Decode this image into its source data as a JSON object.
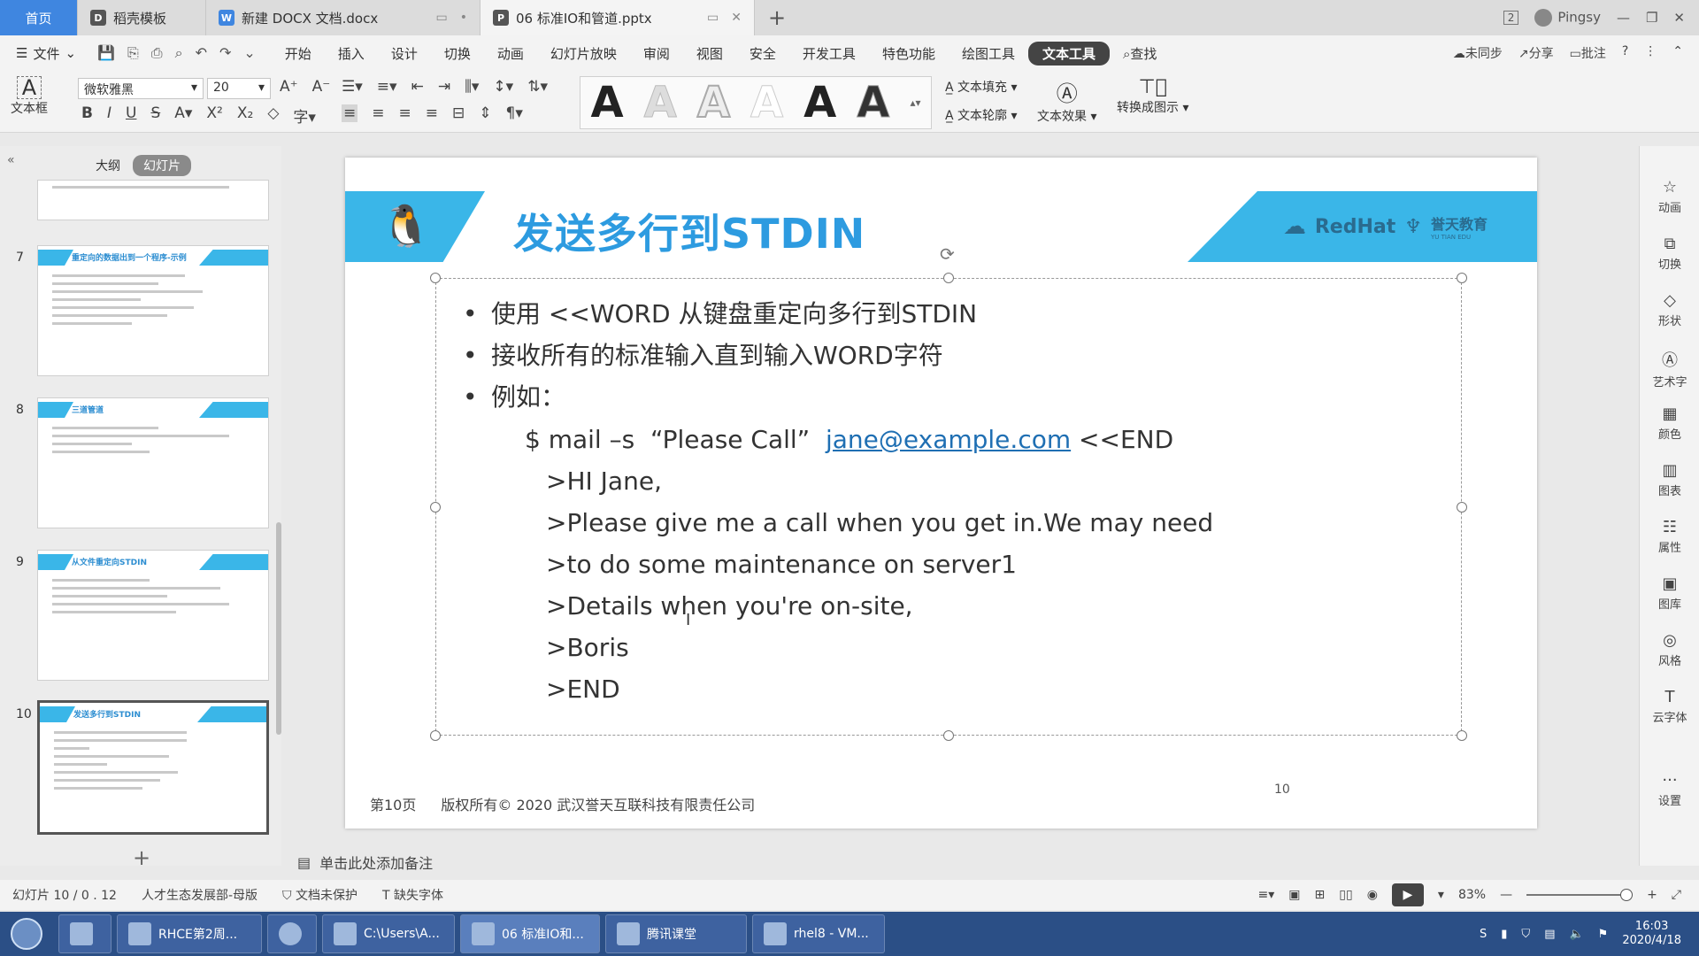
{
  "tabs": [
    {
      "label": "首页"
    },
    {
      "label": "稻壳模板"
    },
    {
      "label": "新建 DOCX 文档.docx"
    },
    {
      "label": "06 标准IO和管道.pptx"
    }
  ],
  "tabbar": {
    "window_count": "2",
    "user": "Pingsy"
  },
  "menu": {
    "file": "文件",
    "items": [
      "开始",
      "插入",
      "设计",
      "切换",
      "动画",
      "幻灯片放映",
      "审阅",
      "视图",
      "安全",
      "开发工具",
      "特色功能",
      "绘图工具"
    ],
    "active": "文本工具",
    "search": "查找",
    "sync": "未同步",
    "share": "分享",
    "comment": "批注"
  },
  "ribbon": {
    "textbox_label": "文本框",
    "font_name": "微软雅黑",
    "font_size": "20",
    "text_fill": "文本填充",
    "text_outline": "文本轮廓",
    "text_effect": "文本效果",
    "convert": "转换成图示",
    "style_glyph": "A"
  },
  "left_panel": {
    "tab_outline": "大纲",
    "tab_slides": "幻灯片",
    "thumbs": [
      {
        "num": "7",
        "title": "重定向的数据出到一个程序-示例"
      },
      {
        "num": "8",
        "title": "三道管道"
      },
      {
        "num": "9",
        "title": "从文件重定向STDIN"
      },
      {
        "num": "10",
        "title": "发送多行到STDIN"
      }
    ],
    "add": "+"
  },
  "slide": {
    "title": "发送多行到STDIN",
    "brand_redhat": "RedHat",
    "brand_yutian": "誉天教育",
    "brand_yutian_sub": "YU TIAN EDU",
    "bullets": [
      "使用 <<WORD 从键盘重定向多行到STDIN",
      "接收所有的标准输入直到输入WORD字符",
      "例如："
    ],
    "command_prefix": "$ mail –s  “Please Call”  ",
    "email": "jane@example.com",
    "command_suffix": " <<END",
    "heredoc": [
      ">HI Jane,",
      ">Please give me a call when you get in.We may need",
      ">to do some maintenance on server1",
      ">Details when you're on-site,",
      ">Boris",
      ">END"
    ],
    "footer_page": "第10页",
    "footer_copyright": "版权所有© 2020 武汉誉天互联科技有限责任公司",
    "page_number": "10"
  },
  "right_panel": [
    "动画",
    "切换",
    "形状",
    "艺术字",
    "颜色",
    "图表",
    "属性",
    "图库",
    "风格",
    "云字体",
    "设置"
  ],
  "notes_placeholder": "单击此处添加备注",
  "status": {
    "slide_info": "幻灯片 10 / 0 . 12",
    "theme": "人才生态发展部-母版",
    "protect": "文档未保护",
    "missing_font": "缺失字体",
    "zoom": "83%"
  },
  "taskbar": [
    {
      "label": "RHCE第2周..."
    },
    {
      "label": "C:\\Users\\A..."
    },
    {
      "label": "06 标准IO和..."
    },
    {
      "label": "腾讯课堂"
    },
    {
      "label": "rhel8 - VM..."
    }
  ],
  "clock": {
    "time": "16:03",
    "date": "2020/4/18"
  },
  "colors": {
    "accent": "#3ab6e8",
    "title": "#2d9be0",
    "taskbar": "#2b4f86",
    "home_tab": "#3f86e0"
  }
}
